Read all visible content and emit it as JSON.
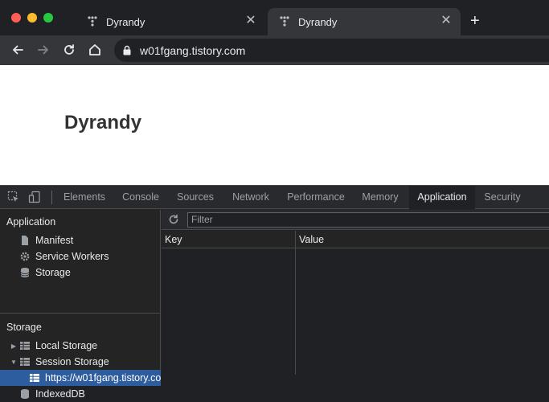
{
  "browser": {
    "tabs": [
      {
        "title": "Dyrandy",
        "close": "✕"
      },
      {
        "title": "Dyrandy",
        "close": "✕"
      }
    ],
    "new_tab": "+",
    "url": "w01fgang.tistory.com"
  },
  "page": {
    "title": "Dyrandy"
  },
  "devtools": {
    "tabs": [
      "Elements",
      "Console",
      "Sources",
      "Network",
      "Performance",
      "Memory",
      "Application",
      "Security"
    ],
    "active_tab": "Application",
    "sidebar": {
      "application_title": "Application",
      "application_items": [
        "Manifest",
        "Service Workers",
        "Storage"
      ],
      "storage_title": "Storage",
      "storage_items": [
        "Local Storage",
        "Session Storage",
        "https://w01fgang.tistory.co",
        "IndexedDB"
      ]
    },
    "filter_placeholder": "Filter",
    "columns": [
      "Key",
      "Value"
    ]
  },
  "colors": {
    "selected_bg": "#2d5d9f",
    "red": "#ff5f57",
    "yellow": "#febc2e",
    "green": "#28c840"
  }
}
